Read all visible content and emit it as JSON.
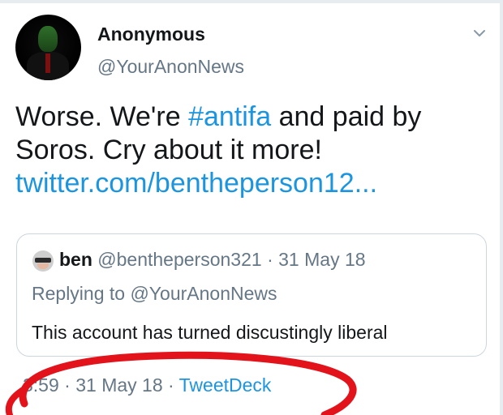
{
  "user": {
    "display_name": "Anonymous",
    "handle": "@YourAnonNews",
    "avatar_icon": "anonymous-mask-avatar"
  },
  "tweet": {
    "text_part1": "Worse. We're ",
    "hashtag": "#antifa",
    "text_part2": " and paid by Soros. Cry about it more! ",
    "link": "twitter.com/bentheperson12..."
  },
  "quote": {
    "name": "ben",
    "handle": "@bentheperson321",
    "separator": " · ",
    "date": "31 May 18",
    "replying_to": "Replying to @YourAnonNews",
    "text": "This account has turned discustingly liberal"
  },
  "meta": {
    "time": "3:59",
    "separator1": " · ",
    "date": "31 May 18",
    "separator2": " · ",
    "source": "TweetDeck"
  },
  "colors": {
    "link": "#1b95e0",
    "secondary_text": "#657786",
    "annotation": "#e3131b",
    "border": "#ccd6dd"
  },
  "icons": [
    "chevron-down-icon"
  ]
}
